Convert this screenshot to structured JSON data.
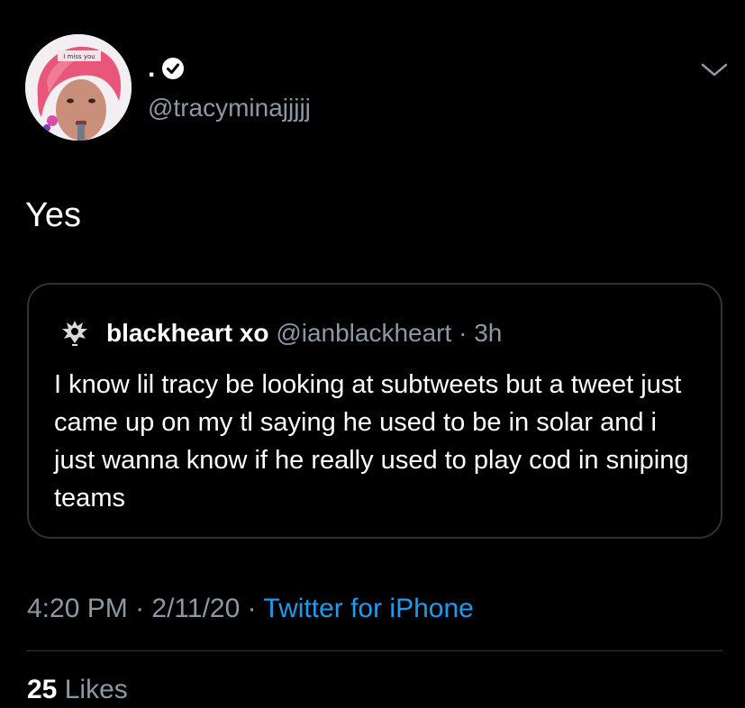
{
  "tweet": {
    "display_name": ".",
    "handle": "@tracyminajjjjj",
    "text": "Yes",
    "avatar_caption": "I miss you",
    "time": "4:20 PM",
    "date": "2/11/20",
    "source": "Twitter for iPhone",
    "sep": " · ",
    "likes_count": "25",
    "likes_label": "Likes"
  },
  "quoted": {
    "name": "blackheart xo",
    "handle": "@ianblackheart",
    "sep": " · ",
    "age": "3h",
    "text": "I know lil tracy be looking at subtweets but a tweet just came up on my tl saying he used to be in solar and i just wanna know if he really used to play cod in sniping teams"
  },
  "icons": {
    "verified": "verified-badge-icon",
    "chevron": "chevron-down-icon"
  },
  "colors": {
    "background": "#000000",
    "text": "#ffffff",
    "muted": "#8b98a5",
    "link": "#1d9bf0",
    "border": "#2f3336",
    "avatar_hair": "#e8567a"
  }
}
